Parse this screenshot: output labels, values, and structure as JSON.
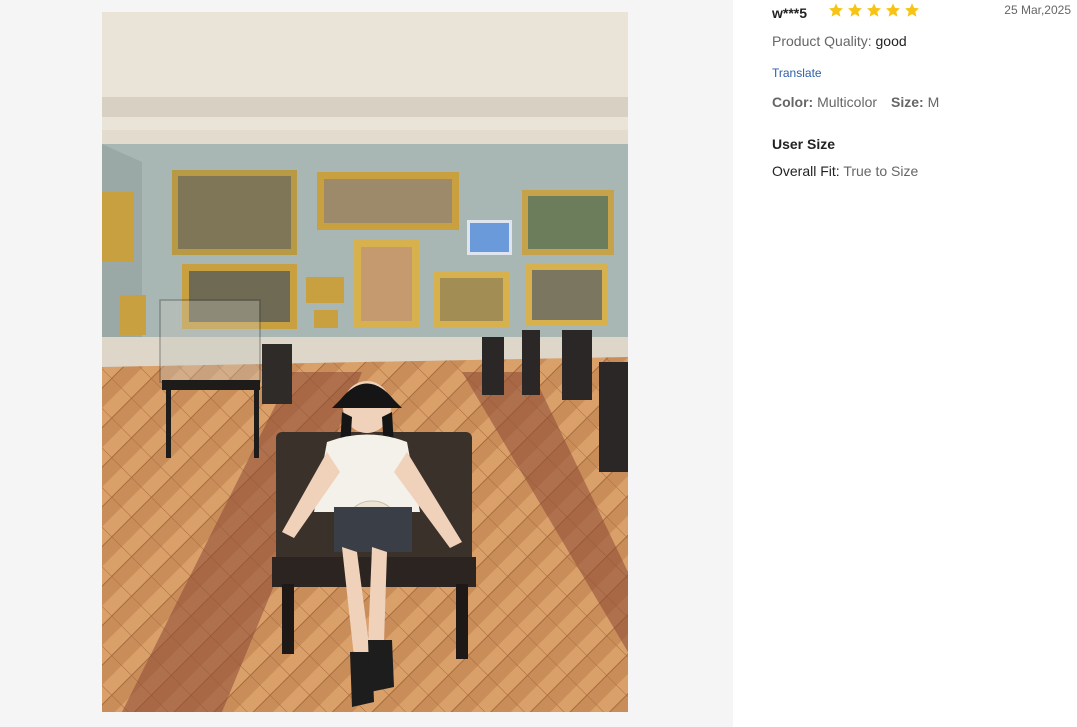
{
  "review": {
    "reviewer": "w***5",
    "rating": 5,
    "date": "25 Mar,2025",
    "quality_label": "Product Quality:",
    "quality_value": "good",
    "translate_label": "Translate",
    "color_label": "Color:",
    "color_value": "Multicolor",
    "size_label": "Size:",
    "size_value": "M",
    "user_size_title": "User Size",
    "fit_label": "Overall Fit:",
    "fit_value": "True to Size"
  },
  "colors": {
    "star": "#f7c314",
    "link": "#2f5fa8",
    "panel_bg": "#f5f5f5"
  }
}
